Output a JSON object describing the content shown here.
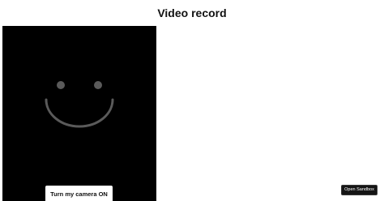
{
  "page": {
    "title": "Video record"
  },
  "video": {
    "placeholder_icon": "smiley-face-icon",
    "background_color": "#000000",
    "icon_color": "#5a5a5a"
  },
  "controls": {
    "camera_button_label": "Turn my camera ON"
  },
  "footer": {
    "open_sandbox_label": "Open Sandbox"
  }
}
